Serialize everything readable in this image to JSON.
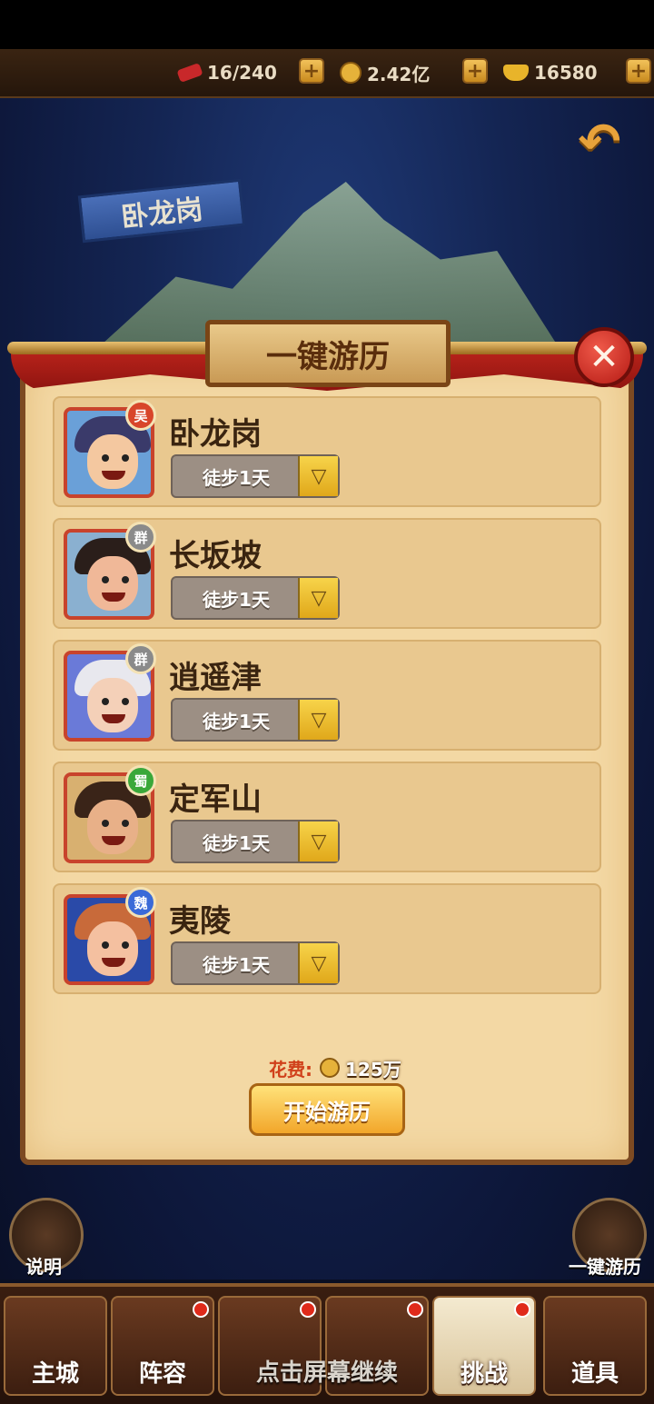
{
  "resources": {
    "stamina": "16/240",
    "coins": "2.42亿",
    "ingots": "16580"
  },
  "map": {
    "location_label": "卧龙岗"
  },
  "dialog": {
    "title": "一键游历",
    "close_label": "✕",
    "rows": [
      {
        "name": "卧龙岗",
        "kingdom": "吴",
        "travel": "徒步1天",
        "badge_color": "#d8452a"
      },
      {
        "name": "长坂坡",
        "kingdom": "群",
        "travel": "徒步1天",
        "badge_color": "#8a8a8a"
      },
      {
        "name": "逍遥津",
        "kingdom": "群",
        "travel": "徒步1天",
        "badge_color": "#8a8a8a"
      },
      {
        "name": "定军山",
        "kingdom": "蜀",
        "travel": "徒步1天",
        "badge_color": "#3aa83a"
      },
      {
        "name": "夷陵",
        "kingdom": "魏",
        "travel": "徒步1天",
        "badge_color": "#3a6ad8"
      }
    ],
    "cost_label": "花费:",
    "cost_value": "125万",
    "start_button": "开始游历"
  },
  "side": {
    "left_label": "说明",
    "right_label": "一键游历"
  },
  "bottom_nav": {
    "tabs": [
      {
        "label": "主城",
        "badge": false
      },
      {
        "label": "阵容",
        "badge": true
      },
      {
        "label": "",
        "badge": true
      },
      {
        "label": "",
        "badge": true
      },
      {
        "label": "挑战",
        "badge": true
      },
      {
        "label": "道具",
        "badge": false
      }
    ],
    "continue_hint": "点击屏幕继续"
  }
}
